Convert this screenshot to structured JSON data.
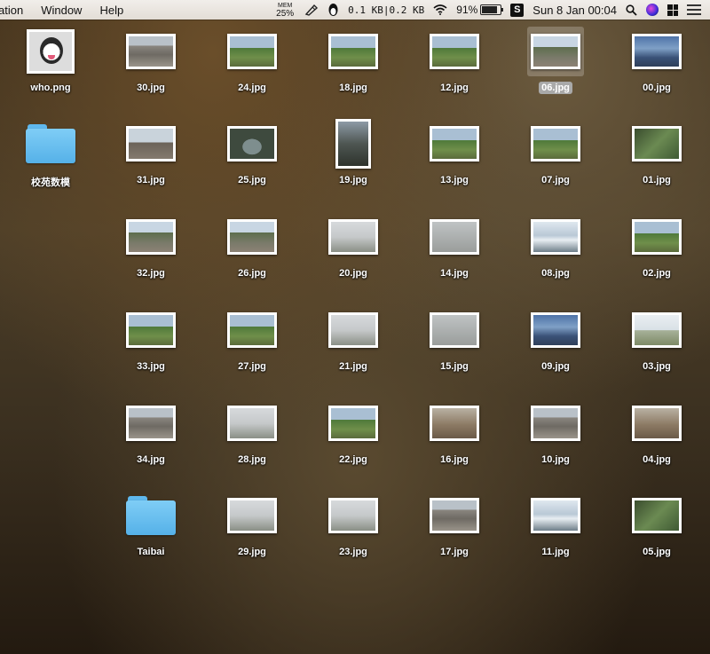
{
  "menubar": {
    "menus": [
      "ation",
      "Window",
      "Help"
    ],
    "mem_label": "MEM",
    "mem_value": "25%",
    "network": "0.1 KB|0.2 KB",
    "battery": "91%",
    "battery_level": 0.91,
    "clock": "Sun 8 Jan  00:04"
  },
  "desktop": {
    "columns": [
      [
        {
          "label": "who.png",
          "kind": "image",
          "shape": "sq",
          "look": "dog"
        },
        {
          "label": "校苑数模",
          "kind": "folder"
        }
      ],
      [
        {
          "label": "30.jpg",
          "look": "p-rock"
        },
        {
          "label": "31.jpg",
          "look": "p-red"
        },
        {
          "label": "32.jpg",
          "look": "p-mtn"
        },
        {
          "label": "33.jpg",
          "look": "p-green"
        },
        {
          "label": "34.jpg",
          "look": "p-rock"
        },
        {
          "label": "Taibai",
          "kind": "folder"
        }
      ],
      [
        {
          "label": "24.jpg",
          "look": "p-green"
        },
        {
          "label": "25.jpg",
          "look": "p-lake"
        },
        {
          "label": "26.jpg",
          "look": "p-mtn"
        },
        {
          "label": "27.jpg",
          "look": "p-green"
        },
        {
          "label": "28.jpg",
          "look": "p-fog"
        },
        {
          "label": "29.jpg",
          "look": "p-fog"
        }
      ],
      [
        {
          "label": "18.jpg",
          "look": "p-green"
        },
        {
          "label": "19.jpg",
          "look": "p-dark",
          "shape": "port"
        },
        {
          "label": "20.jpg",
          "look": "p-fog"
        },
        {
          "label": "21.jpg",
          "look": "p-fog"
        },
        {
          "label": "22.jpg",
          "look": "p-green"
        },
        {
          "label": "23.jpg",
          "look": "p-fog"
        }
      ],
      [
        {
          "label": "12.jpg",
          "look": "p-green"
        },
        {
          "label": "13.jpg",
          "look": "p-green"
        },
        {
          "label": "14.jpg",
          "look": "p-grey"
        },
        {
          "label": "15.jpg",
          "look": "p-grey"
        },
        {
          "label": "16.jpg",
          "look": "p-warm"
        },
        {
          "label": "17.jpg",
          "look": "p-rock"
        }
      ],
      [
        {
          "label": "06.jpg",
          "look": "p-mtn",
          "selected": true
        },
        {
          "label": "07.jpg",
          "look": "p-green"
        },
        {
          "label": "08.jpg",
          "look": "p-sea"
        },
        {
          "label": "09.jpg",
          "look": "p-blue"
        },
        {
          "label": "10.jpg",
          "look": "p-rock"
        },
        {
          "label": "11.jpg",
          "look": "p-sea"
        }
      ],
      [
        {
          "label": "00.jpg",
          "look": "p-blue"
        },
        {
          "label": "01.jpg",
          "look": "p-forest"
        },
        {
          "label": "02.jpg",
          "look": "p-green"
        },
        {
          "label": "03.jpg",
          "look": "p-white"
        },
        {
          "label": "04.jpg",
          "look": "p-warm"
        },
        {
          "label": "05.jpg",
          "look": "p-forest"
        }
      ]
    ]
  },
  "icons": {
    "wifi": "wifi-icon",
    "qq": "qq-penguin-icon",
    "sogou_letter": "S",
    "spotlight": "spotlight-search-icon",
    "siri": "siri-icon",
    "notification": "notification-center-icon"
  }
}
